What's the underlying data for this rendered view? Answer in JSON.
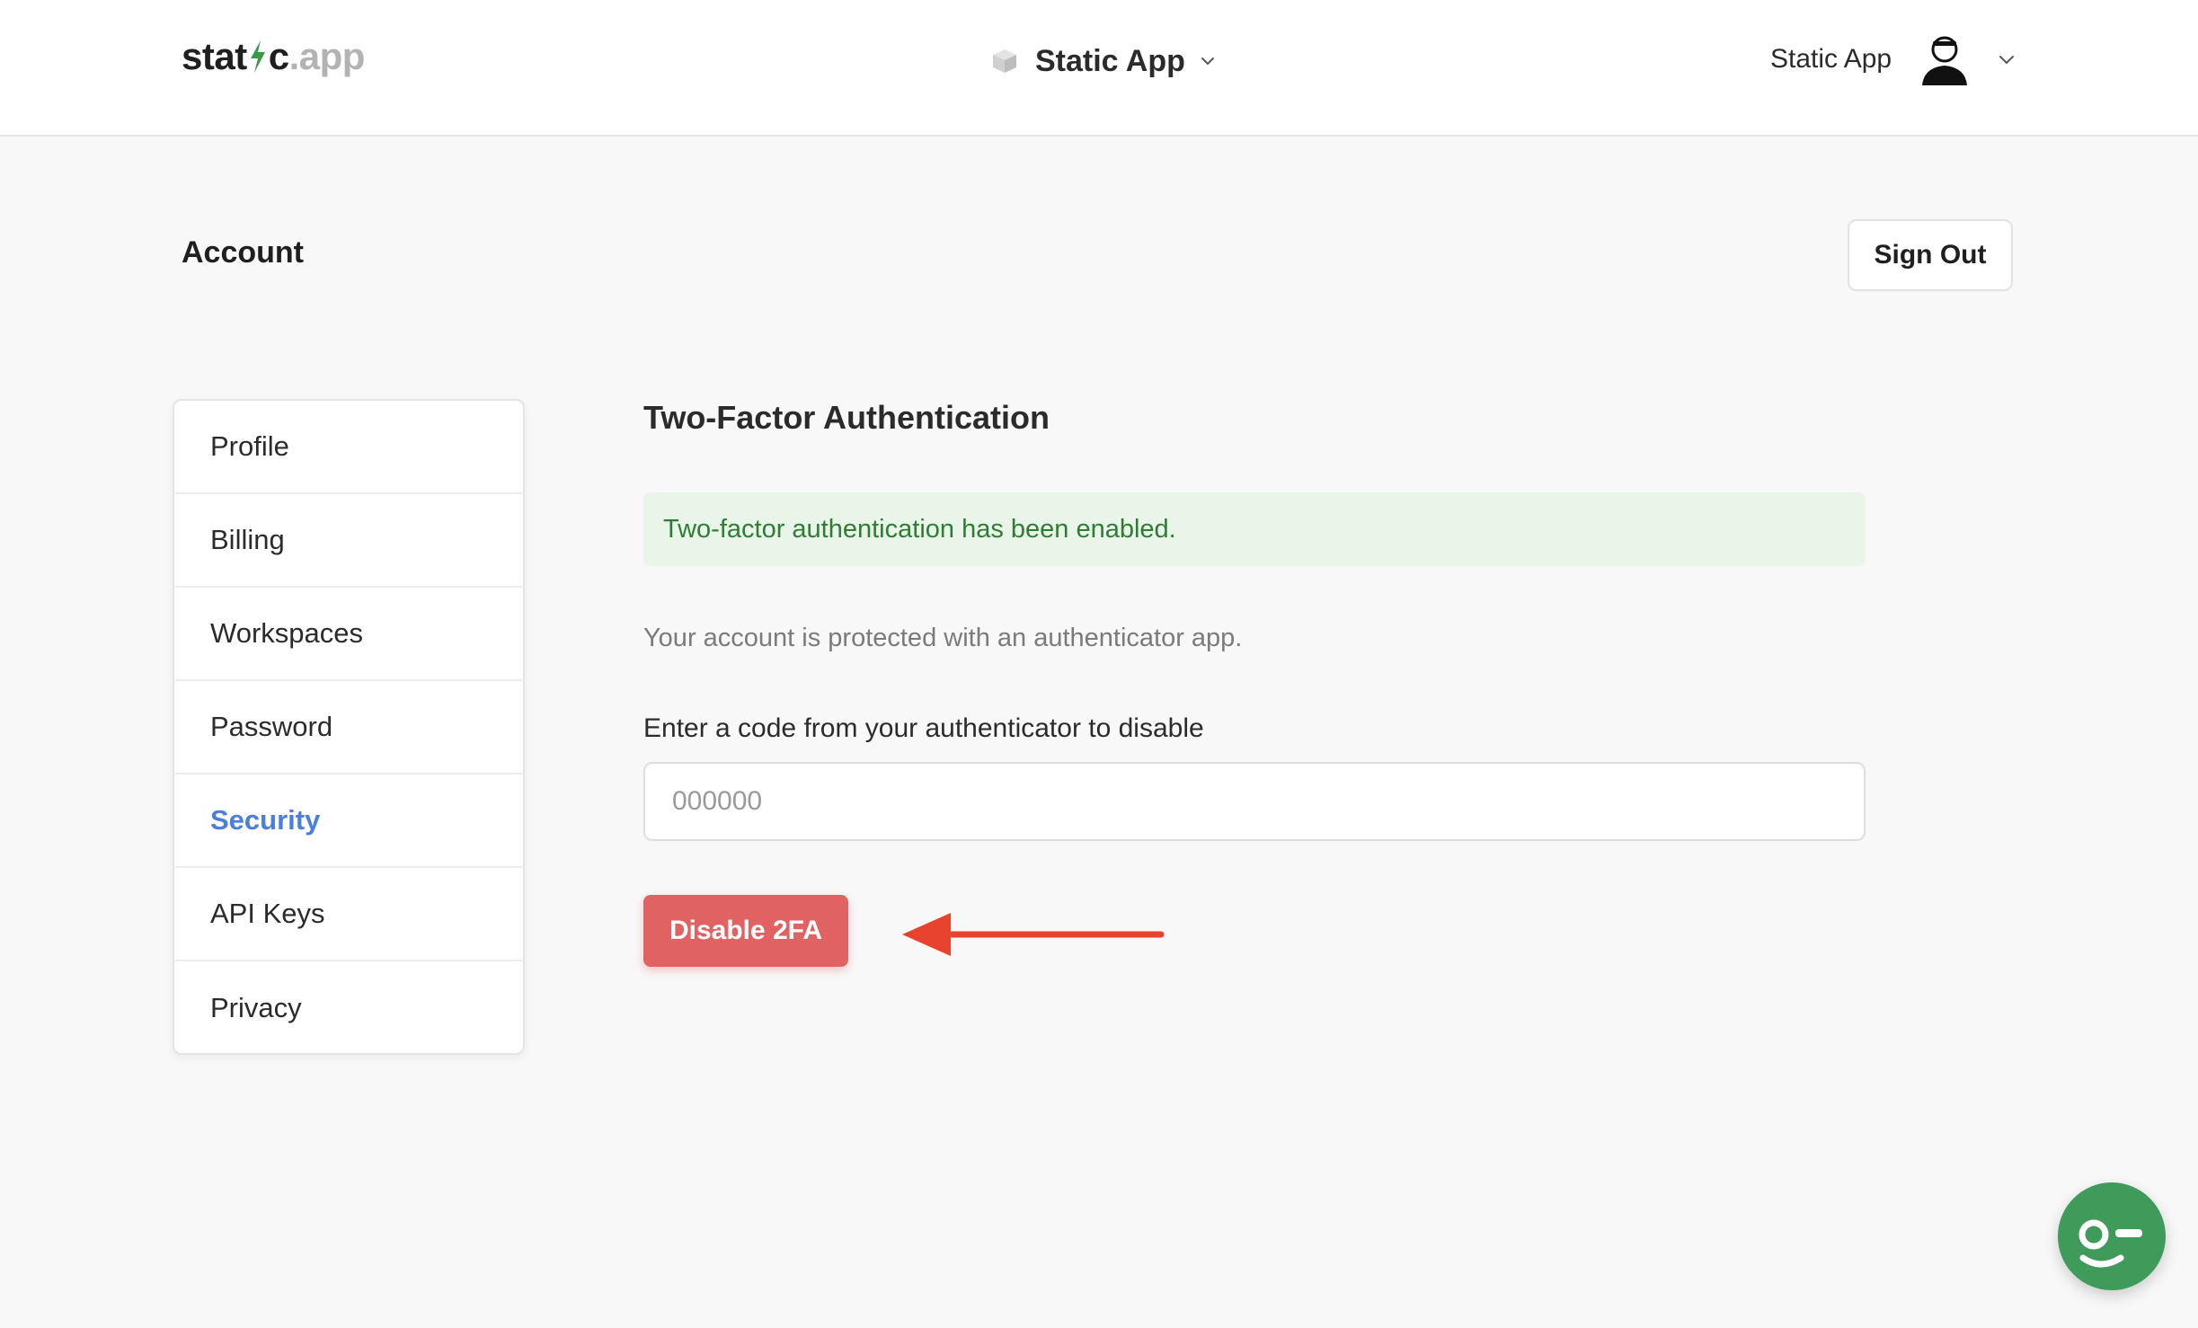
{
  "header": {
    "logo": {
      "part1": "stat",
      "part2": "c",
      "part3": ".app"
    },
    "workspace": {
      "name": "Static App",
      "icon": "cube-icon"
    },
    "user": {
      "name": "Static App",
      "avatar": "user-avatar"
    }
  },
  "page": {
    "title": "Account",
    "signout_label": "Sign Out"
  },
  "sidebar": {
    "items": [
      {
        "label": "Profile",
        "active": false
      },
      {
        "label": "Billing",
        "active": false
      },
      {
        "label": "Workspaces",
        "active": false
      },
      {
        "label": "Password",
        "active": false
      },
      {
        "label": "Security",
        "active": true
      },
      {
        "label": "API Keys",
        "active": false
      },
      {
        "label": "Privacy",
        "active": false
      }
    ]
  },
  "main": {
    "title": "Two-Factor Authentication",
    "alert": "Two-factor authentication has been enabled.",
    "description": "Your account is protected with an authenticator app.",
    "code_label": "Enter a code from your authenticator to disable",
    "code_placeholder": "000000",
    "code_value": "",
    "disable_label": "Disable 2FA"
  },
  "colors": {
    "accent": "#4a7ee0",
    "danger": "#e06262",
    "success_bg": "#eaf5ea",
    "success_text": "#2e7d32",
    "arrow": "#e8432e",
    "chat": "#3e9b5a"
  }
}
